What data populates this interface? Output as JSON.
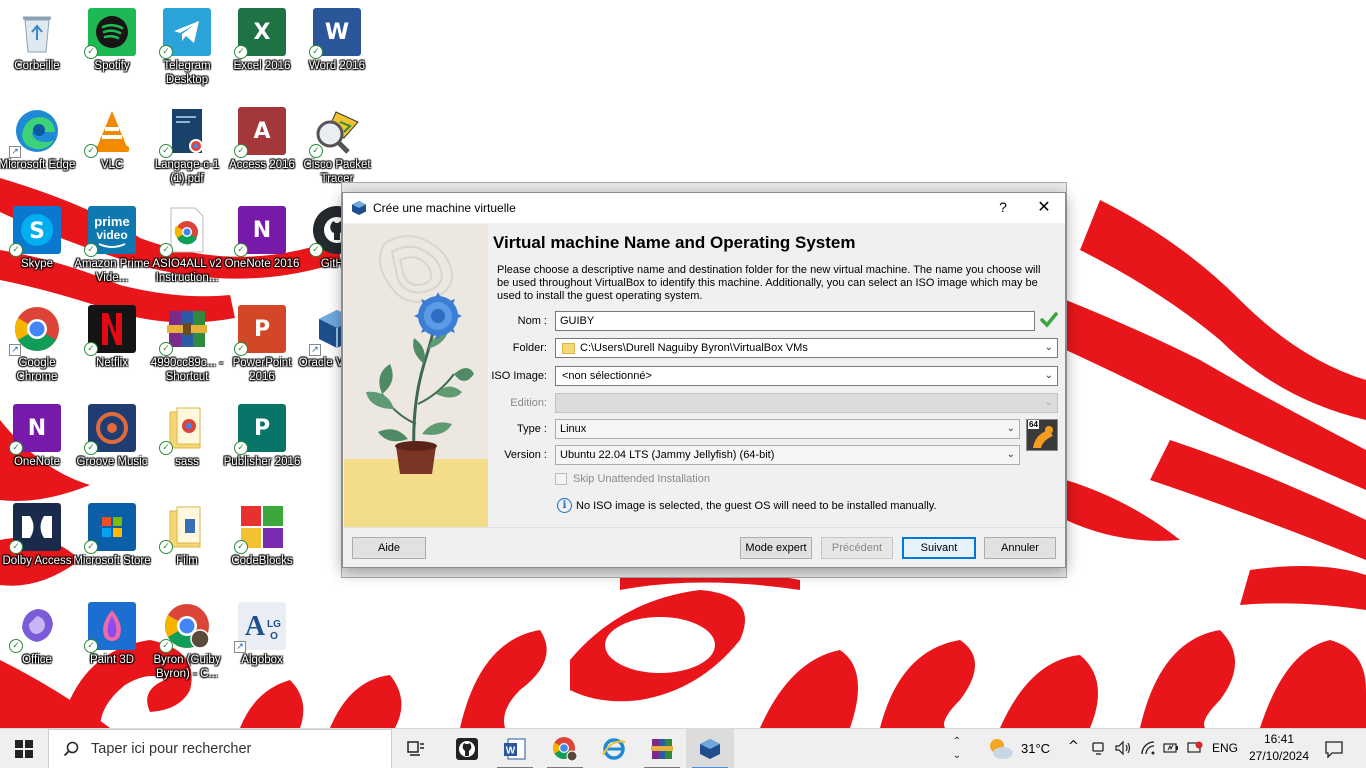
{
  "desktop": {
    "icons": [
      {
        "label": "Corbeille",
        "icon": "recycle-bin-icon",
        "badge": "none"
      },
      {
        "label": "Spotify",
        "icon": "spotify-icon",
        "badge": "sync"
      },
      {
        "label": "Telegram Desktop",
        "icon": "telegram-icon",
        "badge": "sync"
      },
      {
        "label": "Excel 2016",
        "icon": "excel-icon",
        "badge": "sync"
      },
      {
        "label": "Word 2016",
        "icon": "word-icon",
        "badge": "sync"
      },
      {
        "label": "Microsoft Edge",
        "icon": "edge-icon",
        "badge": "shortcut"
      },
      {
        "label": "VLC",
        "icon": "vlc-icon",
        "badge": "sync"
      },
      {
        "label": "Langage-c-1 (1).pdf",
        "icon": "pdf-icon",
        "badge": "sync"
      },
      {
        "label": "Access 2016",
        "icon": "access-icon",
        "badge": "sync"
      },
      {
        "label": "Cisco Packet Tracer",
        "icon": "packet-tracer-icon",
        "badge": "sync"
      },
      {
        "label": "Skype",
        "icon": "skype-icon",
        "badge": "sync"
      },
      {
        "label": "Amazon Prime Vide...",
        "icon": "prime-video-icon",
        "badge": "sync"
      },
      {
        "label": "ASIO4ALL v2 Instruction...",
        "icon": "chrome-file-icon",
        "badge": "sync"
      },
      {
        "label": "OneNote 2016",
        "icon": "onenote-icon",
        "badge": "sync"
      },
      {
        "label": "GitH...",
        "icon": "github-icon",
        "badge": "sync"
      },
      {
        "label": "Google Chrome",
        "icon": "chrome-icon",
        "badge": "shortcut"
      },
      {
        "label": "Netflix",
        "icon": "netflix-icon",
        "badge": "sync"
      },
      {
        "label": "4990cc89c... - Shortcut",
        "icon": "winrar-icon",
        "badge": "sync"
      },
      {
        "label": "PowerPoint 2016",
        "icon": "powerpoint-icon",
        "badge": "sync"
      },
      {
        "label": "Oracle Virtua...",
        "icon": "virtualbox-icon",
        "badge": "shortcut"
      },
      {
        "label": "OneNote",
        "icon": "onenote-app-icon",
        "badge": "sync"
      },
      {
        "label": "Groove Music",
        "icon": "groove-music-icon",
        "badge": "sync"
      },
      {
        "label": "sass",
        "icon": "folder-icon",
        "badge": "sync"
      },
      {
        "label": "Publisher 2016",
        "icon": "publisher-icon",
        "badge": "sync"
      },
      {
        "label": "Dolby Access",
        "icon": "dolby-icon",
        "badge": "sync"
      },
      {
        "label": "Microsoft Store",
        "icon": "store-icon",
        "badge": "sync"
      },
      {
        "label": "Film",
        "icon": "folder-icon",
        "badge": "sync"
      },
      {
        "label": "CodeBlocks",
        "icon": "codeblocks-icon",
        "badge": "sync"
      },
      {
        "label": "Office",
        "icon": "office-icon",
        "badge": "sync"
      },
      {
        "label": "Paint 3D",
        "icon": "paint3d-icon",
        "badge": "sync"
      },
      {
        "label": "Byron (Guiby Byron) - C...",
        "icon": "chrome-profile-icon",
        "badge": "sync"
      },
      {
        "label": "Algobox",
        "icon": "algobox-icon",
        "badge": "shortcut"
      }
    ]
  },
  "dialog": {
    "window_title": "Crée une machine virtuelle",
    "help_label": "?",
    "close_label": "✕",
    "heading": "Virtual machine Name and Operating System",
    "description": "Please choose a descriptive name and destination folder for the new virtual machine. The name you choose will be used throughout VirtualBox to identify this machine. Additionally, you can select an ISO image which may be used to install the guest operating system.",
    "fields": {
      "name_label": "Nom :",
      "name_value": "GUIBY",
      "folder_label": "Folder:",
      "folder_value": "C:\\Users\\Durell Naguiby Byron\\VirtualBox VMs",
      "iso_label": "ISO Image:",
      "iso_value": "<non sélectionné>",
      "edition_label": "Edition:",
      "edition_value": "",
      "type_label": "Type :",
      "type_value": "Linux",
      "version_label": "Version :",
      "version_value": "Ubuntu 22.04 LTS (Jammy Jellyfish) (64-bit)",
      "skip_unattended_label": "Skip Unattended Installation",
      "skip_unattended_checked": false,
      "os_badge": "64"
    },
    "info_message": "No ISO image is selected, the guest OS will need to be installed manually.",
    "buttons": {
      "help": "Aide",
      "expert_mode": "Mode expert",
      "previous": "Précédent",
      "next": "Suivant",
      "cancel": "Annuler"
    }
  },
  "taskbar": {
    "search_placeholder": "Taper ici pour rechercher",
    "apps": [
      {
        "name": "task-view",
        "running": false
      },
      {
        "name": "github-desktop",
        "running": false
      },
      {
        "name": "word",
        "running": true
      },
      {
        "name": "chrome",
        "running": true
      },
      {
        "name": "internet-explorer",
        "running": false
      },
      {
        "name": "winrar",
        "running": true
      },
      {
        "name": "virtualbox",
        "running": true,
        "active": true
      }
    ],
    "weather_temp": "31°C",
    "language": "ENG",
    "time": "16:41",
    "date": "27/10/2024"
  },
  "colors": {
    "accent": "#0078d7",
    "wallpaper_red": "#e8161b",
    "valid_green": "#3aa63a"
  }
}
